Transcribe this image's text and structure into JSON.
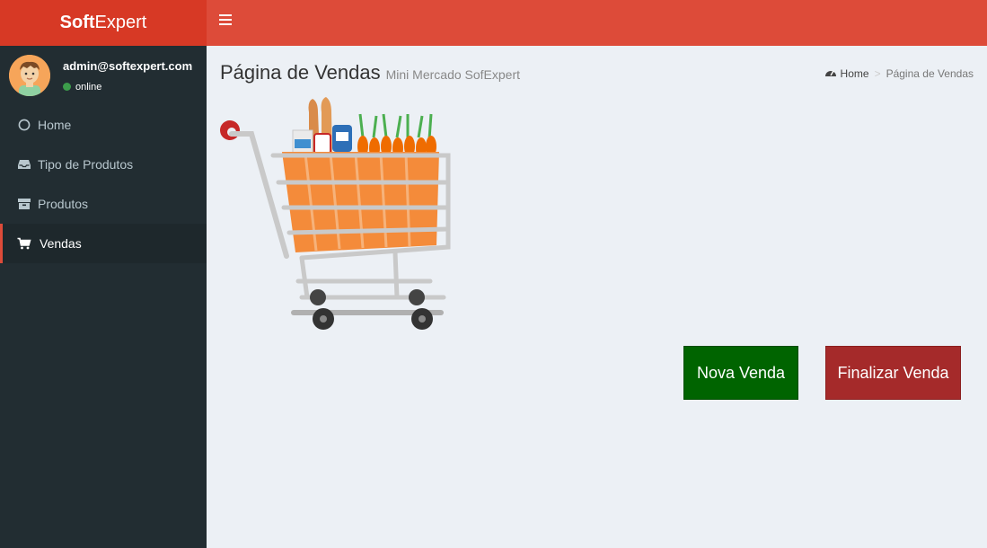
{
  "brand": {
    "bold": "Soft",
    "normal": "Expert",
    "color": "#dd4b39"
  },
  "user": {
    "email": "admin@softexpert.com",
    "status": "online"
  },
  "sidebar": {
    "items": [
      {
        "label": "Home",
        "icon": "circle-icon"
      },
      {
        "label": "Tipo de Produtos",
        "icon": "inbox-icon"
      },
      {
        "label": "Produtos",
        "icon": "package-icon"
      },
      {
        "label": "Vendas",
        "icon": "shopping-cart-icon",
        "active": true
      }
    ]
  },
  "page": {
    "title": "Página de Vendas",
    "subtitle": "Mini Mercado SofExpert"
  },
  "breadcrumb": {
    "home": "Home",
    "current": "Página de Vendas"
  },
  "actions": {
    "new_sale": "Nova Venda",
    "finish_sale": "Finalizar Venda"
  }
}
